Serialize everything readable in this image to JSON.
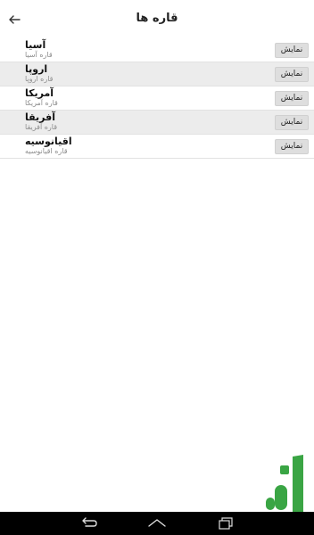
{
  "header": {
    "title": "قاره ها",
    "back_icon": "arrow-left-icon"
  },
  "continents": [
    {
      "name": "آسیا",
      "subtitle": "قاره آسیا",
      "button": "نمایش"
    },
    {
      "name": "اروپا",
      "subtitle": "قاره اروپا",
      "button": "نمایش"
    },
    {
      "name": "آمریکا",
      "subtitle": "قاره آمریکا",
      "button": "نمایش"
    },
    {
      "name": "آفریقا",
      "subtitle": "قاره آفریقا",
      "button": "نمایش"
    },
    {
      "name": "اقیانوسیه",
      "subtitle": "قاره اقیانوسیه",
      "button": "نمایش"
    }
  ],
  "navbar": {
    "icons": [
      "back-icon",
      "home-icon",
      "recents-icon"
    ]
  },
  "colors": {
    "row_alt": "#ececec",
    "button_bg": "#dedede",
    "logo_green": "#3aa544"
  }
}
